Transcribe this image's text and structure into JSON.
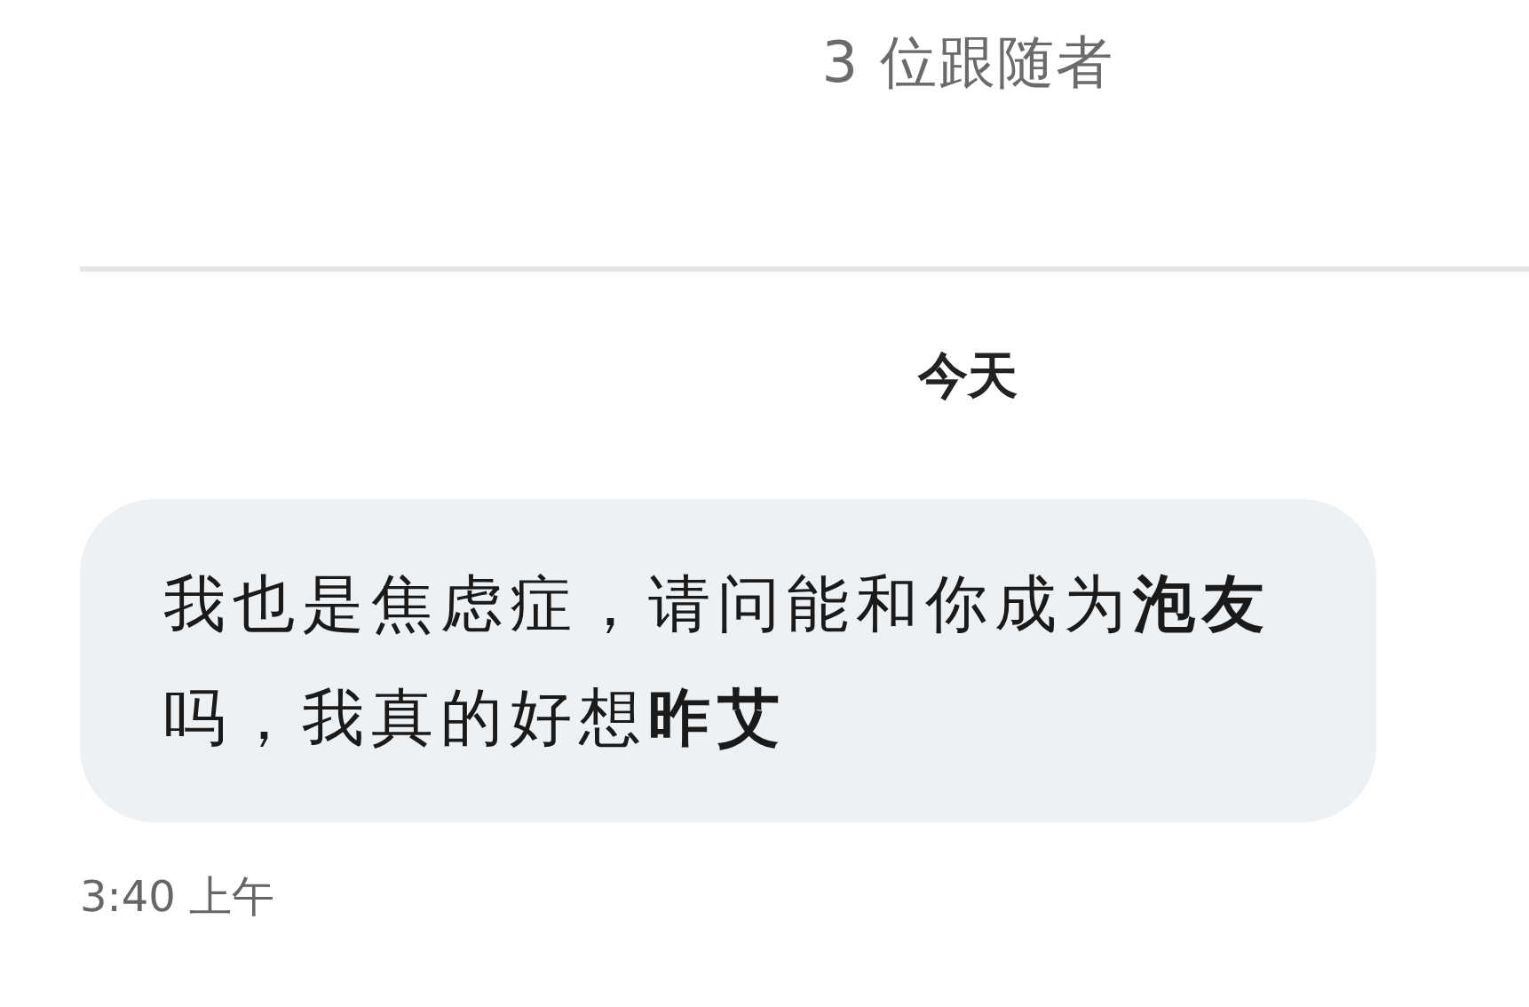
{
  "header": {
    "followers": "3 位跟随者"
  },
  "date_divider": "今天",
  "messages": [
    {
      "text": "我也是焦虑症，请问能和你成为**泡友**吗，我真的好想**昨艾**",
      "time": "3:40 上午"
    }
  ]
}
